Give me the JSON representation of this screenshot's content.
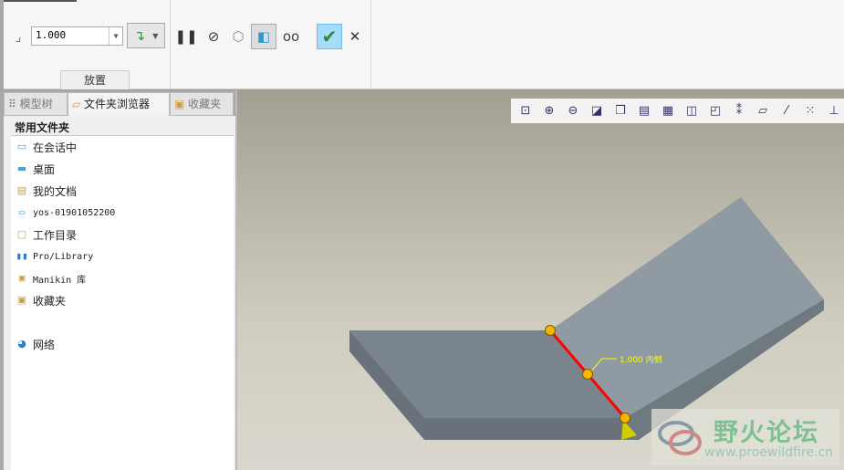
{
  "ribbon": {
    "value": "1.000",
    "placement_tab": "放置",
    "icons": [
      "round-edge-icon",
      "flip-icon",
      "pause-icon",
      "no-preview-icon",
      "preview-wire-icon",
      "preview-shaded-icon",
      "glasses-icon",
      "confirm-icon",
      "cancel-icon"
    ]
  },
  "tabs": [
    {
      "label": "模型树"
    },
    {
      "label": "文件夹浏览器"
    },
    {
      "label": "收藏夹"
    }
  ],
  "folders": {
    "title": "常用文件夹",
    "items": [
      {
        "label": "在会话中",
        "icon": "monitor-icon"
      },
      {
        "label": "桌面",
        "icon": "desktop-icon"
      },
      {
        "label": "我的文档",
        "icon": "documents-icon"
      },
      {
        "label": "yos-01901052200",
        "icon": "computer-icon"
      },
      {
        "label": "工作目录",
        "icon": "work-folder-icon"
      },
      {
        "label": "Pro/Library",
        "icon": "library-icon"
      },
      {
        "label": "Manikin 库",
        "icon": "manikin-folder-icon"
      },
      {
        "label": "收藏夹",
        "icon": "favorites-icon"
      },
      {
        "label": "网络",
        "icon": "network-icon"
      }
    ]
  },
  "viewport": {
    "dimension_label": "1.000 内侧",
    "toolbar": [
      "zoom-fit",
      "zoom-in",
      "zoom-out",
      "repaint",
      "saved-views",
      "view-manager",
      "snapshot",
      "orient",
      "spin-center",
      "datum-display",
      "plane-display",
      "axis-display",
      "point-display",
      "csys-display"
    ]
  },
  "watermark": {
    "title": "野火论坛",
    "url": "www.proewildfire.cn"
  },
  "colors": {
    "edge_highlight": "#ff0000",
    "handle": "#f5b800",
    "confirm_bg": "#a6dcfa"
  }
}
